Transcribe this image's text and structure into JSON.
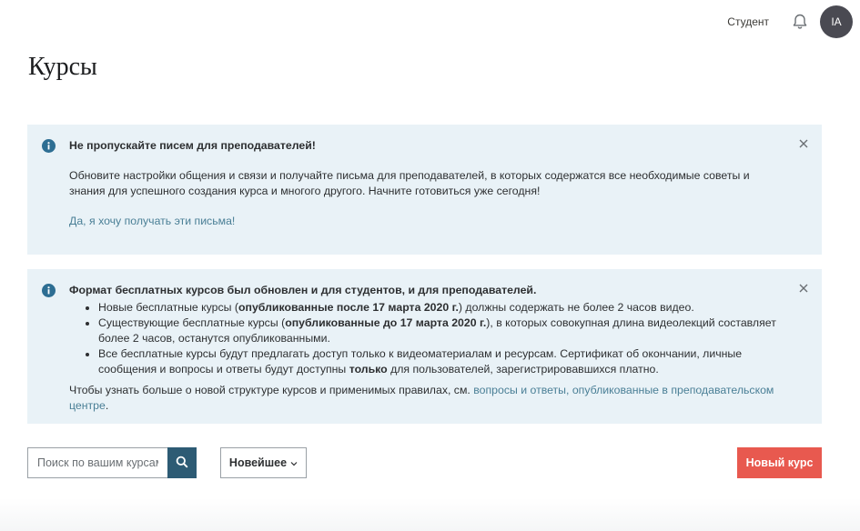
{
  "header": {
    "role_link": "Студент",
    "avatar_initials": "IA",
    "icons": [
      "bell-icon"
    ]
  },
  "page": {
    "title": "Курсы"
  },
  "alert1": {
    "title": "Не пропускайте писем для преподавателей!",
    "body": "Обновите настройки общения и связи и получайте письма для преподавателей, в которых содержатся все необходимые советы и знания для успешного создания курса и многого другого. Начните готовиться уже сегодня!",
    "link": "Да, я хочу получать эти письма!"
  },
  "alert2": {
    "title": "Формат бесплатных курсов был обновлен и для студентов, и для преподавателей.",
    "bullet1": {
      "pre": "Новые бесплатные курсы (",
      "bold": "опубликованные после 17 марта 2020 г.",
      "post": ") должны содержать не более 2 часов видео."
    },
    "bullet2": {
      "pre": "Существующие бесплатные курсы (",
      "bold": "опубликованные до 17 марта 2020 г.",
      "post": "), в которых совокупная длина видеолекций составляет более 2 часов, останутся опубликованными."
    },
    "bullet3": {
      "pre": "Все бесплатные курсы будут предлагать доступ только к видеоматериалам и ресурсам. Сертификат об окончании, личные сообщения и вопросы и ответы будут доступны ",
      "bold": "только",
      "post": " для пользователей, зарегистрировавшихся платно."
    },
    "footer_pre": "Чтобы узнать больше о новой структуре курсов и применимых правилах, см. ",
    "footer_link": "вопросы и ответы, опубликованные в преподавательском центре",
    "footer_post": "."
  },
  "toolbar": {
    "search_placeholder": "Поиск по вашим курсам",
    "sort_label": "Новейшее",
    "new_course_label": "Новый курс"
  },
  "colors": {
    "alert_bg": "#e9f2f7",
    "info_icon": "#2d6e93",
    "link": "#4a7f96",
    "search_button": "#2d5b74",
    "new_course_button": "#e8594f",
    "avatar_bg": "#4a4a52"
  }
}
